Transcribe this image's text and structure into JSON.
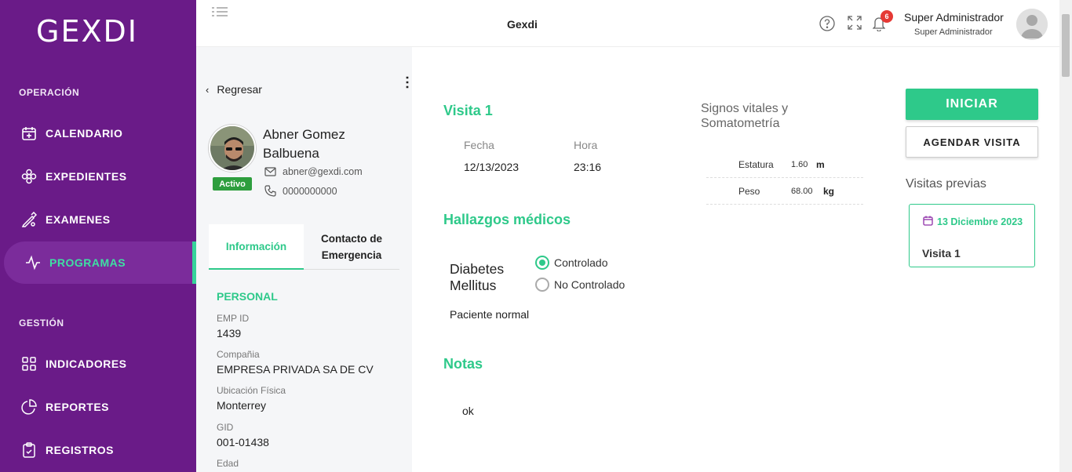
{
  "brand": {
    "logo": "GEXDI",
    "accent": "#2ec98a",
    "sidebar_bg": "#6a1b88"
  },
  "sidebar": {
    "sections": [
      {
        "title": "OPERACIÓN"
      },
      {
        "title": "GESTIÓN"
      }
    ],
    "items": [
      {
        "label": "CALENDARIO",
        "icon": "calendar-icon"
      },
      {
        "label": "EXPEDIENTES",
        "icon": "flower-icon"
      },
      {
        "label": "EXAMENES",
        "icon": "pencil-ruler-icon"
      },
      {
        "label": "PROGRAMAS",
        "icon": "activity-icon",
        "active": true
      },
      {
        "label": "INDICADORES",
        "icon": "grid-icon"
      },
      {
        "label": "REPORTES",
        "icon": "pie-chart-icon"
      },
      {
        "label": "REGISTROS",
        "icon": "clipboard-icon"
      }
    ]
  },
  "topbar": {
    "title": "Gexdi",
    "notifications": "6",
    "user_name": "Super Administrador",
    "user_role": "Super Administrador"
  },
  "patient": {
    "back_label": "Regresar",
    "name": "Abner Gomez Balbuena",
    "status": "Activo",
    "email": "abner@gexdi.com",
    "phone": "0000000000",
    "tabs": [
      "Información",
      "Contacto de Emergencia"
    ],
    "section": "PERSONAL",
    "fields": [
      {
        "label": "EMP ID",
        "value": "1439"
      },
      {
        "label": "Compañia",
        "value": "EMPRESA PRIVADA SA DE CV"
      },
      {
        "label": "Ubicación Física",
        "value": "Monterrey"
      },
      {
        "label": "GID",
        "value": "001-01438"
      },
      {
        "label": "Edad",
        "value": ""
      }
    ]
  },
  "visit": {
    "title": "Visita 1",
    "date_label": "Fecha",
    "date": "12/13/2023",
    "time_label": "Hora",
    "time": "23:16",
    "vitals_title": "Signos vitales y Somatometría",
    "vitals": [
      {
        "label": "Estatura",
        "value": "1.60",
        "unit": "m"
      },
      {
        "label": "Peso",
        "value": "68.00",
        "unit": "kg"
      }
    ],
    "findings_title": "Hallazgos médicos",
    "condition": "Diabetes Mellitus",
    "options": [
      "Controlado",
      "No Controlado"
    ],
    "selected_option": "Controlado",
    "finding_note": "Paciente normal",
    "notes_title": "Notas",
    "notes": "ok"
  },
  "actions": {
    "start": "INICIAR",
    "schedule": "AGENDAR VISITA",
    "previous_title": "Visitas previas",
    "previous": [
      {
        "date": "13 Diciembre 2023",
        "name": "Visita 1"
      }
    ]
  }
}
